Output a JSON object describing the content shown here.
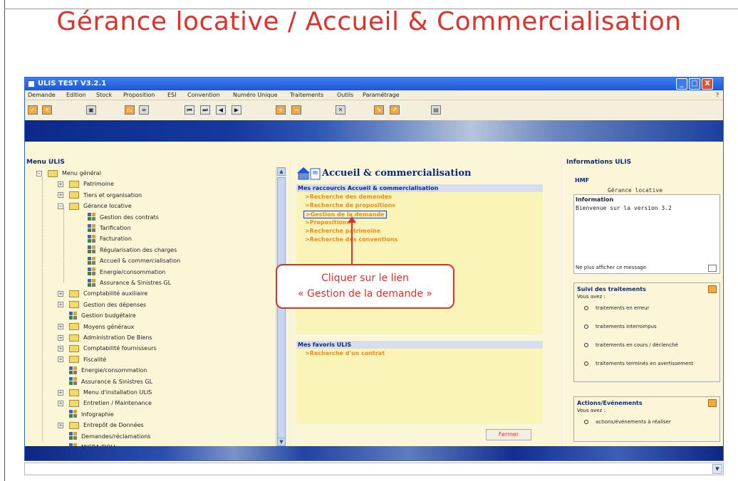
{
  "page": {
    "title": "Gérance locative / Accueil & Commercialisation"
  },
  "window": {
    "title": "ULIS TEST V3.2.1",
    "controls": {
      "minimize": "_",
      "maximize": "□",
      "close": "X"
    }
  },
  "menubar": {
    "items": [
      "Demande",
      "Edition",
      "Stock",
      "Proposition",
      "ESI",
      "Convention",
      "Numéro Unique",
      "Traitements",
      "Outils",
      "Paramétrage"
    ],
    "help": "?"
  },
  "toolbar": {
    "buttons": [
      {
        "icon": "check-icon",
        "glyph": "✓"
      },
      {
        "icon": "close-icon",
        "glyph": "✕"
      },
      {
        "icon": "save-icon",
        "glyph": "▣"
      },
      {
        "icon": "open-folder-icon",
        "glyph": "▭"
      },
      {
        "icon": "binoculars-icon",
        "glyph": "∞"
      },
      {
        "icon": "first-icon",
        "glyph": "⏮"
      },
      {
        "icon": "last-icon",
        "glyph": "⏭"
      },
      {
        "icon": "previous-icon",
        "glyph": "◀"
      },
      {
        "icon": "next-icon",
        "glyph": "▶"
      },
      {
        "icon": "add-icon",
        "glyph": "+"
      },
      {
        "icon": "remove-icon",
        "glyph": "−"
      },
      {
        "icon": "delete-icon",
        "glyph": "✕"
      },
      {
        "icon": "import-icon",
        "glyph": "↘"
      },
      {
        "icon": "export-icon",
        "glyph": "↗"
      },
      {
        "icon": "print-icon",
        "glyph": "▤"
      }
    ]
  },
  "menu_ulis": {
    "title": "Menu ULIS",
    "items": [
      {
        "label": "Menu général",
        "level": 0,
        "kind": "folder",
        "expander": "−"
      },
      {
        "label": "Patrimoine",
        "level": 1,
        "kind": "folder",
        "expander": "+"
      },
      {
        "label": "Tiers et organisation",
        "level": 1,
        "kind": "folder",
        "expander": "+"
      },
      {
        "label": "Gérance locative",
        "level": 1,
        "kind": "folder",
        "expander": "−"
      },
      {
        "label": "Gestion des contrats",
        "level": 2,
        "kind": "doc"
      },
      {
        "label": "Tarification",
        "level": 2,
        "kind": "doc"
      },
      {
        "label": "Facturation",
        "level": 2,
        "kind": "doc"
      },
      {
        "label": "Régularisation des charges",
        "level": 2,
        "kind": "doc"
      },
      {
        "label": "Accueil & commercialisation",
        "level": 2,
        "kind": "doc"
      },
      {
        "label": "Energie/consommation",
        "level": 2,
        "kind": "doc"
      },
      {
        "label": "Assurance & Sinistres GL",
        "level": 2,
        "kind": "doc"
      },
      {
        "label": "Comptabilité auxiliaire",
        "level": 1,
        "kind": "folder",
        "expander": "+"
      },
      {
        "label": "Gestion des dépenses",
        "level": 1,
        "kind": "folder",
        "expander": "+"
      },
      {
        "label": "Gestion budgétaire",
        "level": 1,
        "kind": "doc"
      },
      {
        "label": "Moyens généraux",
        "level": 1,
        "kind": "folder",
        "expander": "+"
      },
      {
        "label": "Administration De Biens",
        "level": 1,
        "kind": "folder",
        "expander": "+"
      },
      {
        "label": "Comptabilité fournisseurs",
        "level": 1,
        "kind": "folder",
        "expander": "+"
      },
      {
        "label": "Fiscalité",
        "level": 1,
        "kind": "folder",
        "expander": "+"
      },
      {
        "label": "Energie/consommation",
        "level": 1,
        "kind": "doc"
      },
      {
        "label": "Assurance & Sinistres GL",
        "level": 1,
        "kind": "doc"
      },
      {
        "label": "Menu d'installation ULIS",
        "level": 1,
        "kind": "folder",
        "expander": "+"
      },
      {
        "label": "Entretien / Maintenance",
        "level": 1,
        "kind": "folder",
        "expander": "+"
      },
      {
        "label": "Infographie",
        "level": 1,
        "kind": "doc"
      },
      {
        "label": "Entrepôt de Données",
        "level": 1,
        "kind": "folder",
        "expander": "+"
      },
      {
        "label": "Demandes/réclamations",
        "level": 1,
        "kind": "doc"
      },
      {
        "label": "MICRA TIQU",
        "level": 1,
        "kind": "doc"
      }
    ]
  },
  "accueil": {
    "title": "Accueil & commercialisation",
    "shortcuts_header": "Mes raccourcis Accueil & commercialisation",
    "shortcuts": [
      ">Recherche des demandes",
      ">Recherche de propositions",
      ">Gestion de la demande",
      ">Propositions",
      ">Recherche patrimoine",
      ">Recherche des conventions"
    ],
    "active_shortcut_index": 2,
    "favorites_header": "Mes favoris ULIS",
    "favorites": [
      ">Recherche d'un contrat"
    ],
    "close_button": "Fermer"
  },
  "informations": {
    "title": "Informations ULIS",
    "org": "HMF",
    "module": "Gérance locative",
    "info_header": "Information",
    "info_text": "Bienvenue sur la version 3.2",
    "no_show_label": "Ne plus afficher ce message",
    "suivi": {
      "title": "Suivi des traitements",
      "subtitle": "Vous avez :",
      "items": [
        "traitements en erreur",
        "traitements interrompus",
        "traitements en cours / déclenché",
        "traitements terminés en avertissement"
      ]
    },
    "actions": {
      "title": "Actions/Evénements",
      "subtitle": "Vous avez :",
      "items": [
        "actions/événements à réaliser"
      ]
    }
  },
  "annotation": {
    "line1": "Cliquer sur le lien",
    "line2": "« Gestion de la demande »"
  },
  "colors": {
    "accent_red": "#e0322a",
    "link_orange": "#f08a1c",
    "navy": "#0d2a7a",
    "titlebar_blue": "#2c6ad8"
  }
}
